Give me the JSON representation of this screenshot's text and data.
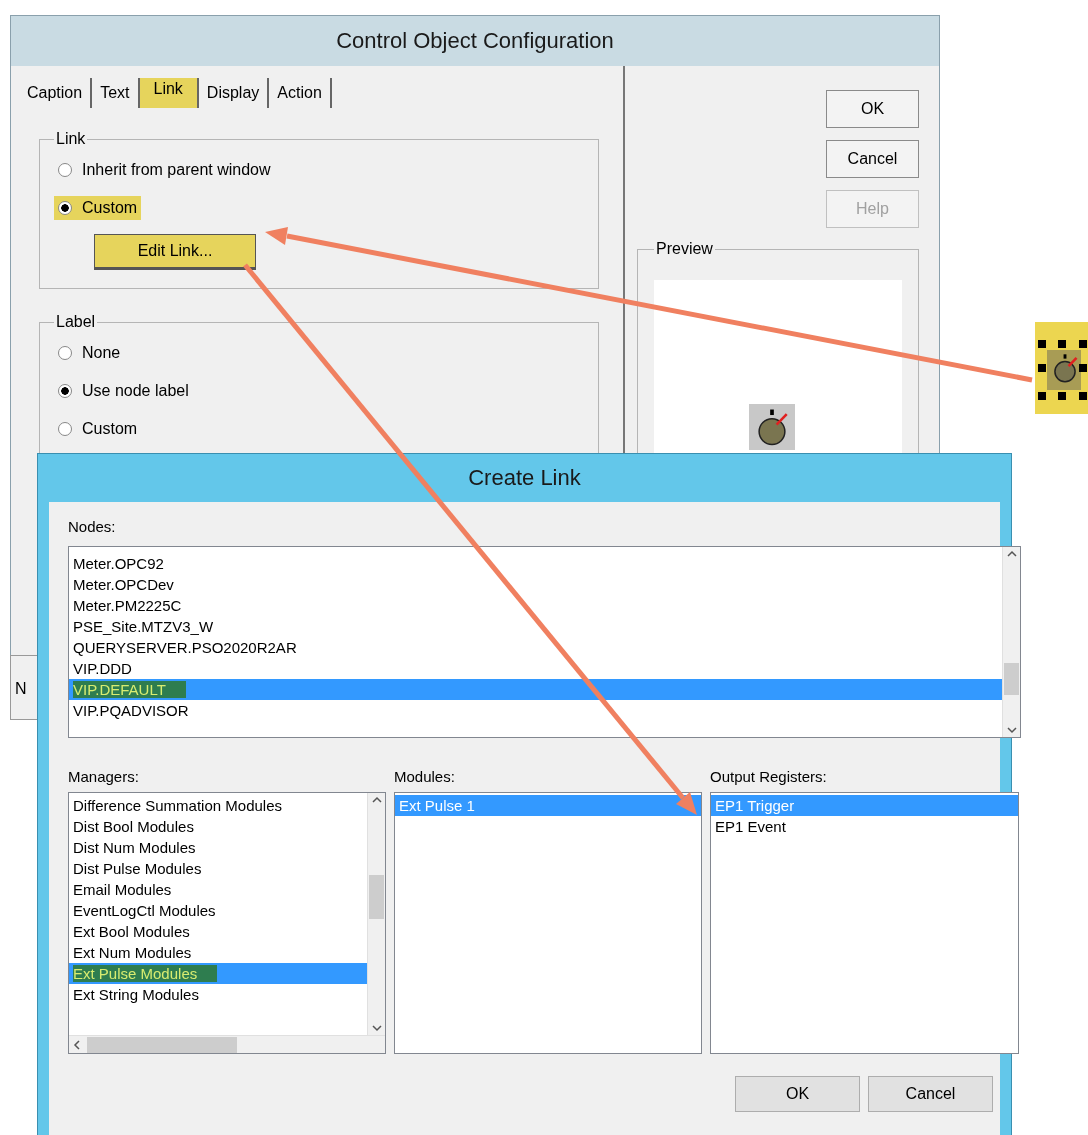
{
  "control_dialog": {
    "title": "Control Object Configuration",
    "tabs": [
      {
        "label": "Caption",
        "selected": false,
        "highlighted": false
      },
      {
        "label": "Text",
        "selected": false,
        "highlighted": false
      },
      {
        "label": "Link",
        "selected": true,
        "highlighted": true
      },
      {
        "label": "Display",
        "selected": false,
        "highlighted": false
      },
      {
        "label": "Action",
        "selected": false,
        "highlighted": false
      }
    ],
    "link_group": {
      "title": "Link",
      "options": [
        {
          "label": "Inherit from parent window",
          "selected": false,
          "highlighted": false
        },
        {
          "label": "Custom",
          "selected": true,
          "highlighted": true
        }
      ],
      "edit_button": {
        "label": "Edit Link...",
        "highlighted": true
      }
    },
    "label_group": {
      "title": "Label",
      "options": [
        {
          "label": "None",
          "selected": false,
          "highlighted": false
        },
        {
          "label": "Use node label",
          "selected": true,
          "highlighted": false
        },
        {
          "label": "Custom",
          "selected": false,
          "highlighted": false
        }
      ]
    },
    "buttons": [
      {
        "label": "OK",
        "disabled": false
      },
      {
        "label": "Cancel",
        "disabled": false
      },
      {
        "label": "Help",
        "disabled": true
      }
    ],
    "preview": {
      "title": "Preview"
    },
    "partial_label": "N"
  },
  "create_link": {
    "title": "Create Link",
    "nodes": {
      "label": "Nodes:",
      "items": [
        {
          "label": "Meter.OPC92",
          "selected": false,
          "highlighted": false
        },
        {
          "label": "Meter.OPCDev",
          "selected": false,
          "highlighted": false
        },
        {
          "label": "Meter.PM2225C",
          "selected": false,
          "highlighted": false
        },
        {
          "label": "PSE_Site.MTZV3_W",
          "selected": false,
          "highlighted": false
        },
        {
          "label": "QUERYSERVER.PSO2020R2AR",
          "selected": false,
          "highlighted": false
        },
        {
          "label": "VIP.DDD",
          "selected": false,
          "highlighted": false
        },
        {
          "label": "VIP.DEFAULT",
          "selected": true,
          "highlighted": true
        },
        {
          "label": "VIP.PQADVISOR",
          "selected": false,
          "highlighted": false
        }
      ]
    },
    "managers": {
      "label": "Managers:",
      "items": [
        {
          "label": "Difference Summation Modules",
          "selected": false,
          "highlighted": false
        },
        {
          "label": "Dist Bool Modules",
          "selected": false,
          "highlighted": false
        },
        {
          "label": "Dist Num Modules",
          "selected": false,
          "highlighted": false
        },
        {
          "label": "Dist Pulse Modules",
          "selected": false,
          "highlighted": false
        },
        {
          "label": "Email Modules",
          "selected": false,
          "highlighted": false
        },
        {
          "label": "EventLogCtl Modules",
          "selected": false,
          "highlighted": false
        },
        {
          "label": "Ext Bool Modules",
          "selected": false,
          "highlighted": false
        },
        {
          "label": "Ext Num Modules",
          "selected": false,
          "highlighted": false
        },
        {
          "label": "Ext Pulse Modules",
          "selected": true,
          "highlighted": true
        },
        {
          "label": "Ext String Modules",
          "selected": false,
          "highlighted": false
        }
      ]
    },
    "modules": {
      "label": "Modules:",
      "items": [
        {
          "label": "Ext Pulse 1",
          "selected": true,
          "highlighted": false
        }
      ]
    },
    "output_registers": {
      "label": "Output Registers:",
      "items": [
        {
          "label": "EP1 Trigger",
          "selected": true,
          "highlighted": false
        },
        {
          "label": "EP1 Event",
          "selected": false,
          "highlighted": false
        }
      ]
    },
    "buttons": [
      "OK",
      "Cancel"
    ]
  }
}
